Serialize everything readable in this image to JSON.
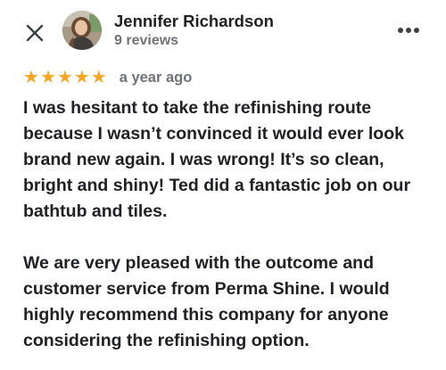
{
  "header": {
    "author_name": "Jennifer Richardson",
    "review_count": "9 reviews",
    "close_icon": "close-icon",
    "more_icon": "more-horizontal-icon"
  },
  "rating": {
    "stars": 5,
    "max_stars": 5,
    "star_color": "#F5A623",
    "date": "a year ago"
  },
  "review": {
    "paragraphs": [
      "I was hesitant to take the refinishing route because I wasn’t convinced it would ever look brand new again. I was wrong! It’s so clean, bright and shiny! Ted did a fantastic job on our bathtub and tiles.",
      "We are very pleased with the outcome and customer service from Perma Shine. I would highly recommend this company for anyone considering the refinishing option."
    ]
  },
  "colors": {
    "text_primary": "#202124",
    "text_secondary": "#6F7378",
    "background": "#FFFFFF"
  }
}
